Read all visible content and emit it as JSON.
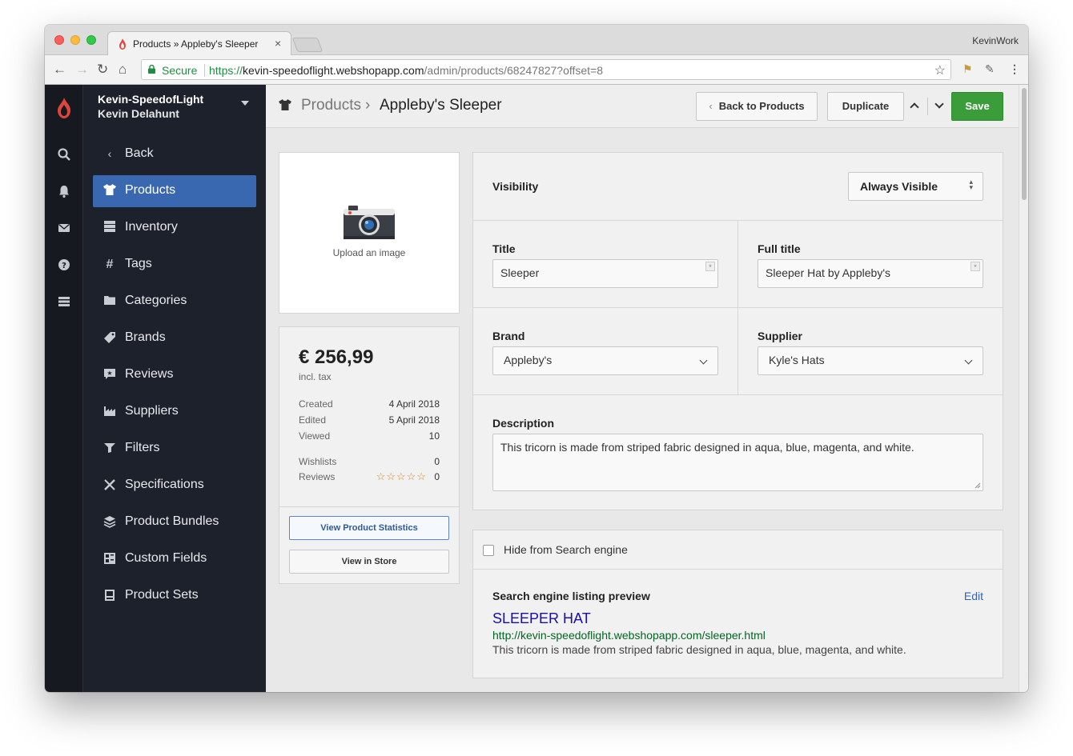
{
  "browser": {
    "tab_title": "Products » Appleby's Sleeper",
    "profile": "KevinWork",
    "secure_label": "Secure",
    "url_scheme": "https://",
    "url_host": "kevin-speedoflight.webshopapp.com",
    "url_path": "/admin/products/68247827?offset=8"
  },
  "account": {
    "shop": "Kevin-SpeedofLight",
    "user": "Kevin Delahunt"
  },
  "nav": [
    {
      "label": "Back",
      "icon": "chevron-left-icon"
    },
    {
      "label": "Products",
      "icon": "shirt-icon",
      "active": true
    },
    {
      "label": "Inventory",
      "icon": "inventory-icon"
    },
    {
      "label": "Tags",
      "icon": "hash-icon"
    },
    {
      "label": "Categories",
      "icon": "folder-icon"
    },
    {
      "label": "Brands",
      "icon": "tag-icon"
    },
    {
      "label": "Reviews",
      "icon": "review-icon"
    },
    {
      "label": "Suppliers",
      "icon": "factory-icon"
    },
    {
      "label": "Filters",
      "icon": "filter-icon"
    },
    {
      "label": "Specifications",
      "icon": "tools-icon"
    },
    {
      "label": "Product Bundles",
      "icon": "layers-icon"
    },
    {
      "label": "Custom Fields",
      "icon": "custom-fields-icon"
    },
    {
      "label": "Product Sets",
      "icon": "product-sets-icon"
    }
  ],
  "header": {
    "breadcrumb_parent": "Products",
    "breadcrumb_sep": "›",
    "breadcrumb_current": "Appleby's Sleeper",
    "back_label": "Back to Products",
    "duplicate_label": "Duplicate",
    "save_label": "Save"
  },
  "image": {
    "upload_label": "Upload an image"
  },
  "stats": {
    "price": "€ 256,99",
    "incl_tax": "incl. tax",
    "created_label": "Created",
    "created_value": "4 April 2018",
    "edited_label": "Edited",
    "edited_value": "5 April 2018",
    "viewed_label": "Viewed",
    "viewed_value": "10",
    "wishlists_label": "Wishlists",
    "wishlists_value": "0",
    "reviews_label": "Reviews",
    "reviews_value": "0",
    "rating_stars": "☆☆☆☆☆",
    "view_stats_label": "View Product Statistics",
    "view_store_label": "View in Store"
  },
  "form": {
    "visibility_label": "Visibility",
    "visibility_value": "Always Visible",
    "title_label": "Title",
    "title_value": "Sleeper",
    "full_title_label": "Full title",
    "full_title_value": "Sleeper Hat by Appleby's",
    "brand_label": "Brand",
    "brand_value": "Appleby's",
    "supplier_label": "Supplier",
    "supplier_value": "Kyle's Hats",
    "description_label": "Description",
    "description_value": "This tricorn is made from striped fabric designed in aqua, blue, magenta, and white."
  },
  "seo": {
    "hide_label": "Hide from Search engine",
    "heading": "Search engine listing preview",
    "edit_label": "Edit",
    "preview_title": "SLEEPER HAT",
    "preview_url": "http://kevin-speedoflight.webshopapp.com/sleeper.html",
    "preview_desc": "This tricorn is made from striped fabric designed in aqua, blue, magenta, and white."
  },
  "colors": {
    "accent": "#3a68b0",
    "save": "#3b9c3a",
    "sidebar": "#1c212b",
    "brand_logo": "#e0453a"
  }
}
